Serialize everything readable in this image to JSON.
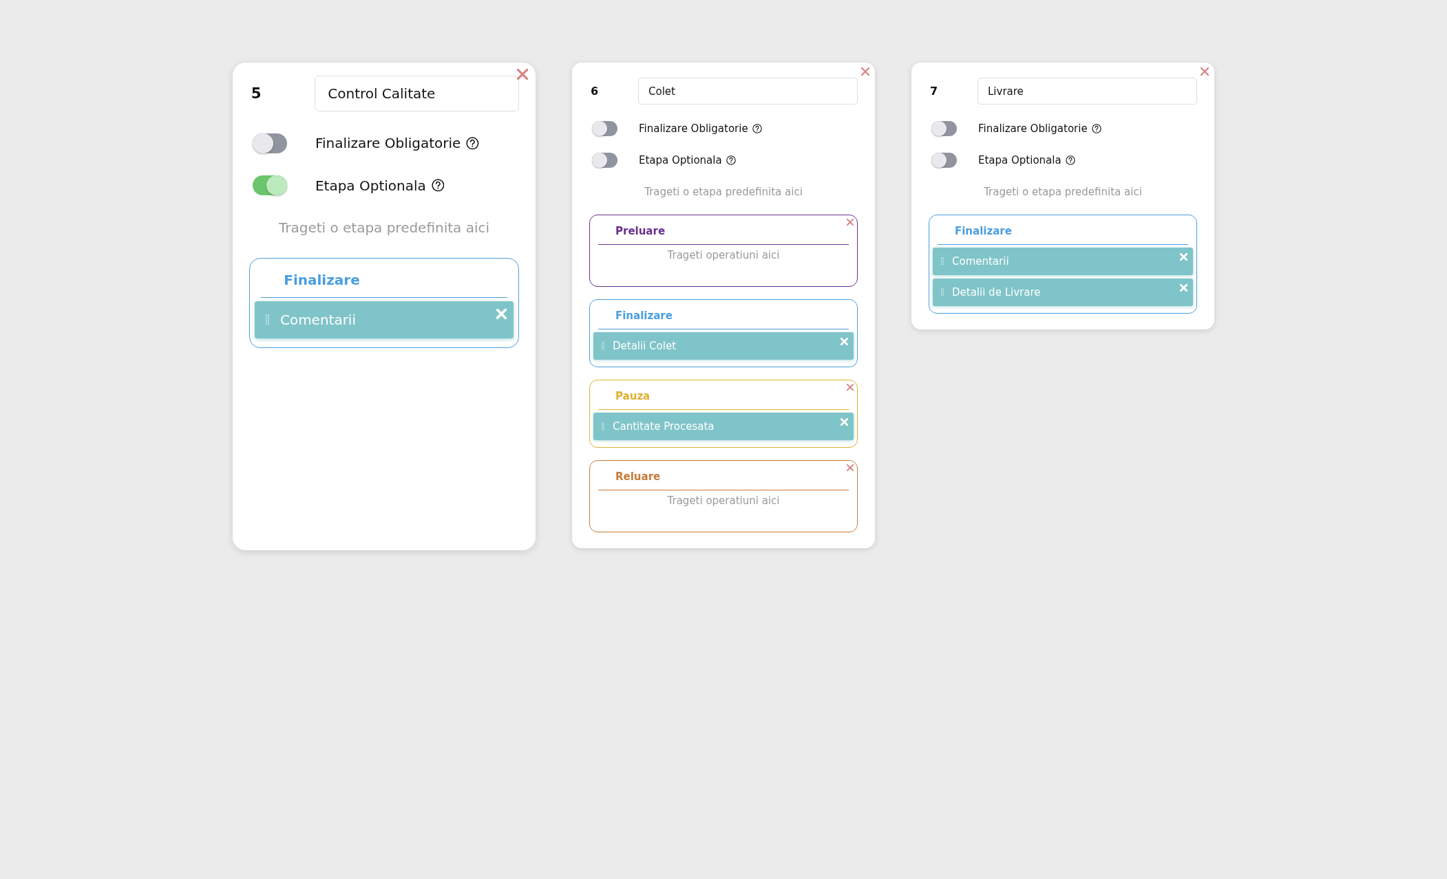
{
  "cards": [
    {
      "number": "5",
      "name": "Control Calitate",
      "toggles": [
        {
          "label": "Finalizare Obligatorie",
          "on": false
        },
        {
          "label": "Etapa Optionala",
          "on": true
        }
      ],
      "drop_hint": "Trageti o etapa predefinita aici",
      "stages": [
        {
          "title": "Finalizare",
          "color": "#4a9ee0",
          "closable": false,
          "operations": [
            "Comentarii"
          ]
        }
      ]
    },
    {
      "number": "6",
      "name": "Colet",
      "toggles": [
        {
          "label": "Finalizare Obligatorie",
          "on": false
        },
        {
          "label": "Etapa Optionala",
          "on": false
        }
      ],
      "drop_hint": "Trageti o etapa predefinita aici",
      "stages": [
        {
          "title": "Preluare",
          "color": "#6a2f8f",
          "closable": true,
          "empty_hint": "Trageti operatiuni aici"
        },
        {
          "title": "Finalizare",
          "color": "#4a9ee0",
          "closable": false,
          "operations": [
            "Detalii Colet"
          ]
        },
        {
          "title": "Pauza",
          "color": "#e0b030",
          "closable": true,
          "operations": [
            "Cantitate Procesata"
          ]
        },
        {
          "title": "Reluare",
          "color": "#c87a3a",
          "closable": true,
          "empty_hint": "Trageti operatiuni aici"
        }
      ]
    },
    {
      "number": "7",
      "name": "Livrare",
      "toggles": [
        {
          "label": "Finalizare Obligatorie",
          "on": false
        },
        {
          "label": "Etapa Optionala",
          "on": false
        }
      ],
      "drop_hint": "Trageti o etapa predefinita aici",
      "stages": [
        {
          "title": "Finalizare",
          "color": "#4a9ee0",
          "closable": false,
          "operations": [
            "Comentarii",
            "Detalii de Livrare"
          ]
        }
      ]
    }
  ]
}
